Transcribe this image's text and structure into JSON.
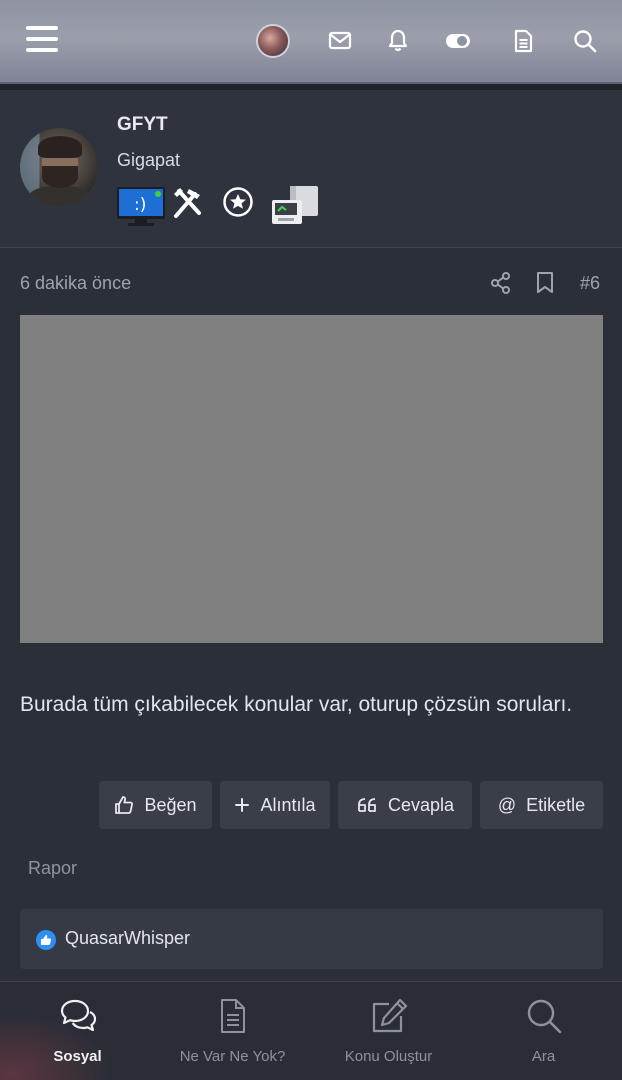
{
  "topbar": {
    "icons": [
      "menu-icon",
      "user-avatar",
      "mail-icon",
      "bell-icon",
      "toggle-icon",
      "document-icon",
      "search-icon"
    ]
  },
  "author": {
    "name": "GFYT",
    "title": "Gigapat",
    "badges": [
      "monitor-bsod-badge",
      "tools-badge",
      "star-circle-badge",
      "computer-badge"
    ]
  },
  "post": {
    "time": "6 dakika önce",
    "number": "#6",
    "text": "Burada tüm çıkabilecek konular var, oturup çözsün soruları.",
    "actions": {
      "like": "Beğen",
      "quote": "Alıntıla",
      "reply": "Cevapla",
      "mention": "Etiketle"
    },
    "report": "Rapor",
    "liked_by": "QuasarWhisper"
  },
  "bottom_nav": [
    {
      "label": "Sosyal",
      "icon": "chat-icon",
      "active": true
    },
    {
      "label": "Ne Var Ne Yok?",
      "icon": "document-icon",
      "active": false
    },
    {
      "label": "Konu Oluştur",
      "icon": "edit-icon",
      "active": false
    },
    {
      "label": "Ara",
      "icon": "search-icon",
      "active": false
    }
  ]
}
